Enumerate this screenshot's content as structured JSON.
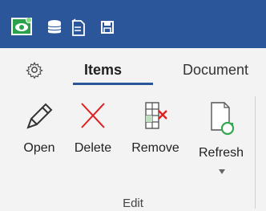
{
  "quick_access": {
    "icons": [
      "app-icon",
      "database-icon",
      "new-document-icon",
      "save-icon"
    ]
  },
  "tabs": [
    {
      "label": "Items",
      "selected": true
    },
    {
      "label": "Document",
      "selected": false
    }
  ],
  "ribbon": {
    "buttons": [
      {
        "label": "Open",
        "icon": "pencil-icon"
      },
      {
        "label": "Delete",
        "icon": "red-x-icon"
      },
      {
        "label": "Remove",
        "icon": "remove-table-icon"
      },
      {
        "label": "Refresh",
        "icon": "refresh-document-icon"
      }
    ],
    "group_label": "Edit"
  },
  "colors": {
    "titlebar": "#2b579a",
    "accent_green": "#32a852",
    "delete_red": "#e02020"
  }
}
